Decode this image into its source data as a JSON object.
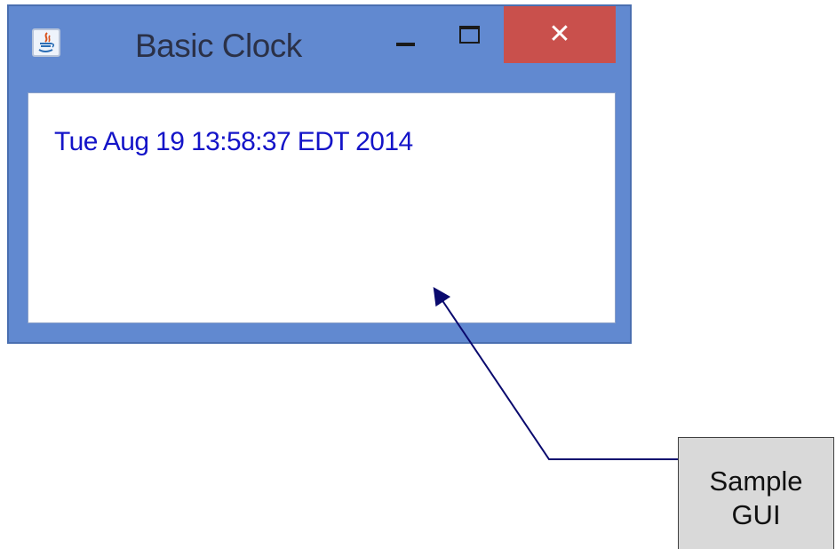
{
  "window": {
    "title": "Basic Clock",
    "minimize_glyph": "",
    "maximize_glyph": "",
    "close_glyph": "✕"
  },
  "content": {
    "clock_text": "Tue Aug 19 13:58:37 EDT 2014"
  },
  "callout": {
    "line1": "Sample",
    "line2": "GUI"
  },
  "colors": {
    "window_frame": "#6189d0",
    "close_button": "#c9504c",
    "clock_text": "#1414c8",
    "callout_fill": "#d9d9d9",
    "arrow": "#0a0a6e"
  }
}
